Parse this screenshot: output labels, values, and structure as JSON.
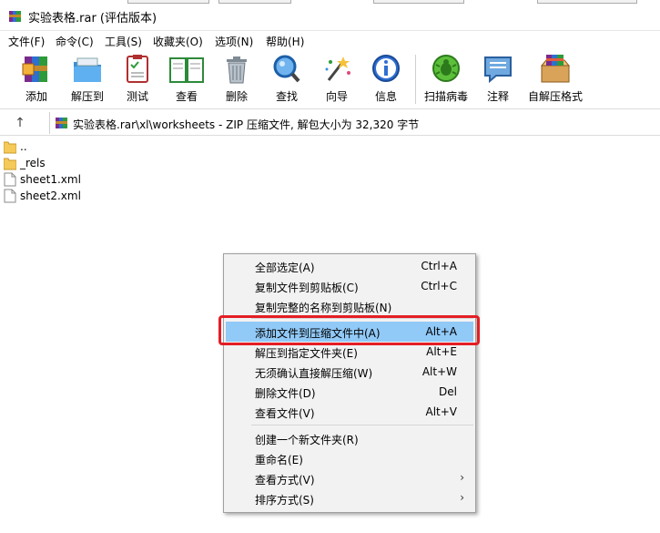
{
  "window": {
    "title": "实验表格.rar (评估版本)"
  },
  "menubar": {
    "items": [
      {
        "label": "文件(F)"
      },
      {
        "label": "命令(C)"
      },
      {
        "label": "工具(S)"
      },
      {
        "label": "收藏夹(O)"
      },
      {
        "label": "选项(N)"
      },
      {
        "label": "帮助(H)"
      }
    ]
  },
  "toolbar": {
    "items": [
      {
        "label": "添加",
        "icon": "add-archive-icon"
      },
      {
        "label": "解压到",
        "icon": "extract-folder-icon"
      },
      {
        "label": "测试",
        "icon": "test-clipboard-icon"
      },
      {
        "label": "查看",
        "icon": "view-book-icon"
      },
      {
        "label": "删除",
        "icon": "trash-can-icon"
      },
      {
        "label": "查找",
        "icon": "magnifier-icon"
      },
      {
        "label": "向导",
        "icon": "wizard-wand-icon"
      },
      {
        "label": "信息",
        "icon": "info-icon"
      },
      {
        "label": "扫描病毒",
        "icon": "virus-scan-icon"
      },
      {
        "label": "注释",
        "icon": "comment-icon"
      },
      {
        "label": "自解压格式",
        "icon": "sfx-box-icon"
      }
    ]
  },
  "addressbar": {
    "path": "实验表格.rar\\xl\\worksheets - ZIP 压缩文件, 解包大小为 32,320 字节"
  },
  "files": [
    {
      "name": "..",
      "type": "folder"
    },
    {
      "name": "_rels",
      "type": "folder"
    },
    {
      "name": "sheet1.xml",
      "type": "file"
    },
    {
      "name": "sheet2.xml",
      "type": "file"
    }
  ],
  "context_menu": {
    "items": [
      {
        "label": "全部选定(A)",
        "shortcut": "Ctrl+A"
      },
      {
        "label": "复制文件到剪贴板(C)",
        "shortcut": "Ctrl+C"
      },
      {
        "label": "复制完整的名称到剪贴板(N)",
        "shortcut": ""
      },
      {
        "label": "添加文件到压缩文件中(A)",
        "shortcut": "Alt+A",
        "highlighted": true
      },
      {
        "label": "解压到指定文件夹(E)",
        "shortcut": "Alt+E"
      },
      {
        "label": "无须确认直接解压缩(W)",
        "shortcut": "Alt+W"
      },
      {
        "label": "删除文件(D)",
        "shortcut": "Del"
      },
      {
        "label": "查看文件(V)",
        "shortcut": "Alt+V"
      },
      {
        "label": "创建一个新文件夹(R)",
        "shortcut": ""
      },
      {
        "label": "重命名(E)",
        "shortcut": ""
      },
      {
        "label": "查看方式(V)",
        "shortcut": "",
        "submenu": true
      },
      {
        "label": "排序方式(S)",
        "shortcut": "",
        "submenu": true
      }
    ],
    "highlight_color": "#91c9f7",
    "annotation_color": "#e41e25"
  }
}
